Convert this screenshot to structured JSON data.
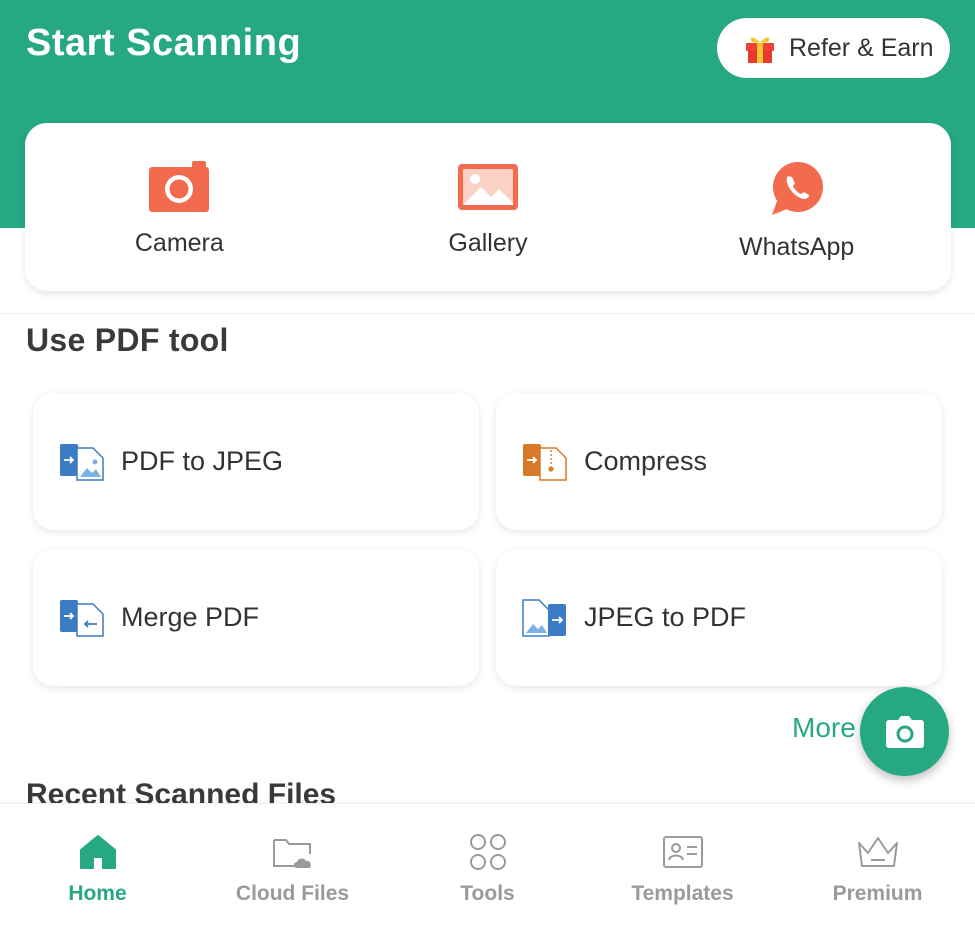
{
  "header": {
    "title": "Start Scanning",
    "refer_label": "Refer & Earn",
    "refer_icon": "gift-icon"
  },
  "scan_options": [
    {
      "label": "Camera",
      "icon": "camera-icon"
    },
    {
      "label": "Gallery",
      "icon": "gallery-icon"
    },
    {
      "label": "WhatsApp",
      "icon": "whatsapp-icon"
    }
  ],
  "pdf_tools": {
    "title": "Use PDF tool",
    "items": [
      {
        "label": "PDF to JPEG",
        "icon": "pdf-to-jpeg-icon"
      },
      {
        "label": "Compress",
        "icon": "compress-icon"
      },
      {
        "label": "Merge PDF",
        "icon": "merge-pdf-icon"
      },
      {
        "label": "JPEG to PDF",
        "icon": "jpeg-to-pdf-icon"
      }
    ],
    "more_label": "More"
  },
  "recent": {
    "title": "Recent Scanned Files"
  },
  "fab": {
    "icon": "camera-icon"
  },
  "bottom_nav": [
    {
      "label": "Home",
      "icon": "home-icon",
      "active": true
    },
    {
      "label": "Cloud Files",
      "icon": "cloud-folder-icon",
      "active": false
    },
    {
      "label": "Tools",
      "icon": "tools-grid-icon",
      "active": false
    },
    {
      "label": "Templates",
      "icon": "id-card-icon",
      "active": false
    },
    {
      "label": "Premium",
      "icon": "crown-icon",
      "active": false
    }
  ],
  "colors": {
    "brand": "#26a883",
    "scan_icon": "#f26b4e",
    "pdf_blue": "#3b7cc4",
    "compress_orange": "#d8792a",
    "inactive_nav": "#9a9a9a"
  }
}
